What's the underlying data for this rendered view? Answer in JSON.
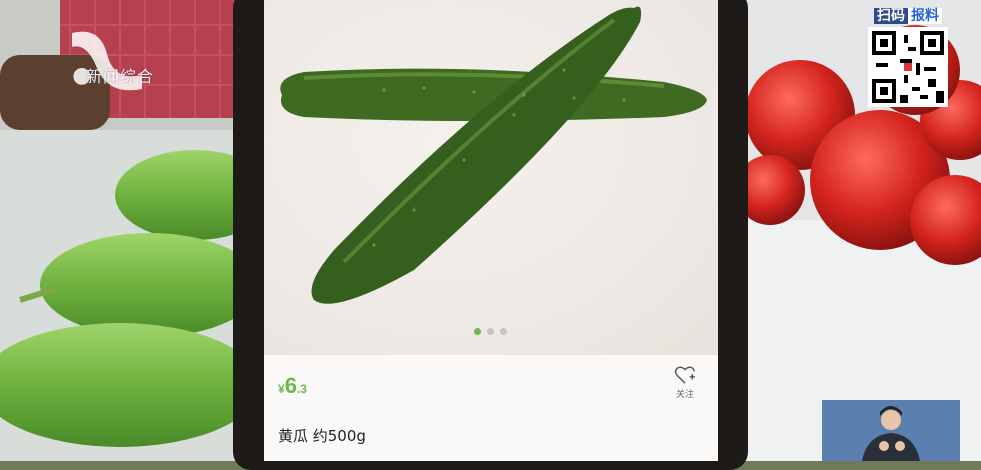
{
  "channel": {
    "logo_text": "新闻综合"
  },
  "qr_badge": {
    "scan_text": "扫码",
    "report_text": "报料"
  },
  "app": {
    "carousel": {
      "dot_count": 3,
      "active_index": 0
    },
    "product": {
      "currency": "¥",
      "price_integer": "6",
      "price_decimal": ".3",
      "name": "黄瓜 约500g"
    },
    "follow_label": "关注"
  },
  "colors": {
    "accent_green": "#6cb84a",
    "screen_bg": "#f5f1ee"
  }
}
